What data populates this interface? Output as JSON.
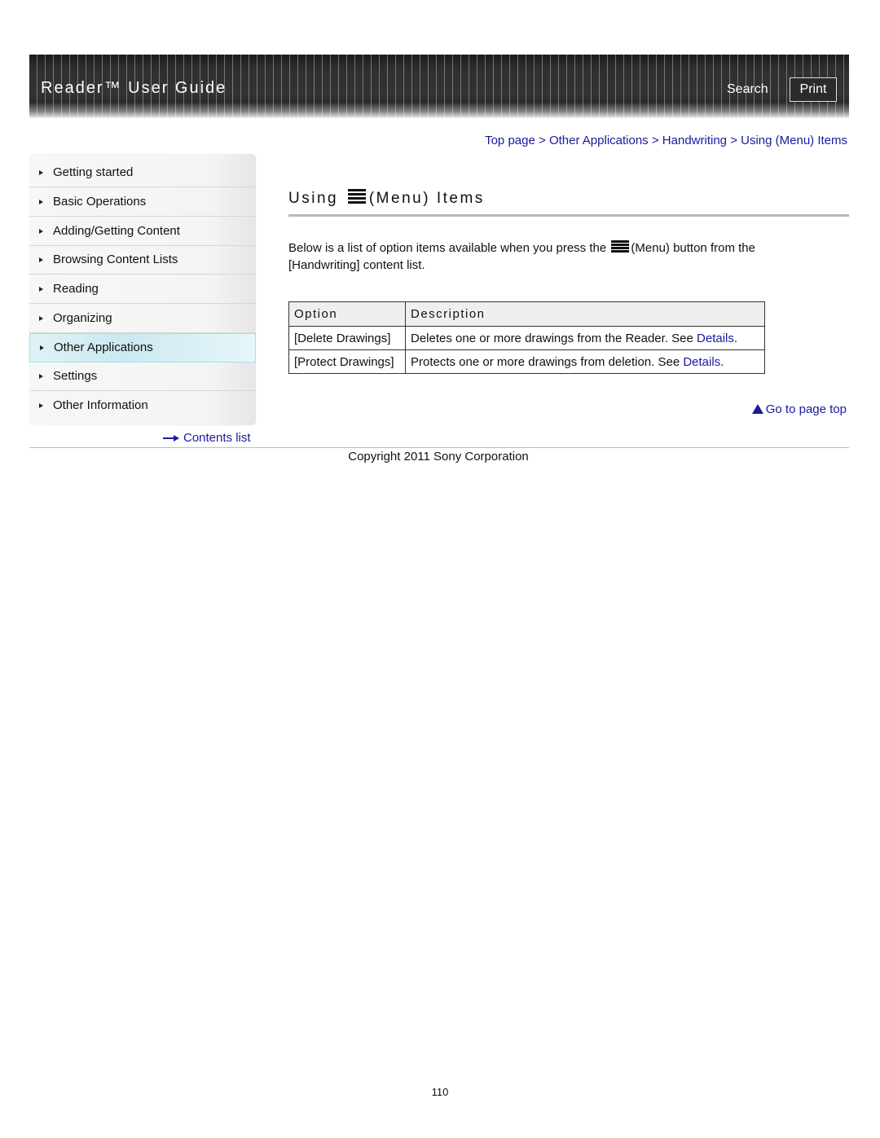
{
  "header": {
    "title": "Reader™ User Guide",
    "search_label": "Search",
    "print_label": "Print"
  },
  "sidebar": {
    "items": [
      {
        "label": "Getting started",
        "active": false
      },
      {
        "label": "Basic Operations",
        "active": false
      },
      {
        "label": "Adding/Getting Content",
        "active": false
      },
      {
        "label": "Browsing Content Lists",
        "active": false
      },
      {
        "label": "Reading",
        "active": false
      },
      {
        "label": "Organizing",
        "active": false
      },
      {
        "label": "Other Applications",
        "active": true
      },
      {
        "label": "Settings",
        "active": false
      },
      {
        "label": "Other Information",
        "active": false
      }
    ],
    "contents_link": "Contents list"
  },
  "breadcrumb": {
    "items": [
      "Top page",
      "Other Applications",
      "Handwriting",
      "Using (Menu) Items"
    ],
    "separator": ">"
  },
  "main": {
    "title_prefix": "Using",
    "title_suffix": "(Menu) Items",
    "title_icon": "menu-icon",
    "intro_part1": "Below is a list of option items available when you press the",
    "intro_part2": "(Menu) button from the [Handwriting] content list.",
    "table": {
      "headers": [
        "Option",
        "Description"
      ],
      "rows": [
        {
          "option": "[Delete Drawings]",
          "description": "Deletes one or more drawings from the Reader. See ",
          "link": "Details",
          "end": "."
        },
        {
          "option": "[Protect Drawings]",
          "description": "Protects one or more drawings from deletion. See ",
          "link": "Details",
          "end": "."
        }
      ]
    },
    "go_to_top": "Go to page top"
  },
  "footer": {
    "copyright": "Copyright 2011 Sony Corporation",
    "page_number": "110"
  },
  "colors": {
    "link": "#1a1a9c",
    "header_bg": "#333333",
    "active_nav": "#cbe9ef"
  }
}
